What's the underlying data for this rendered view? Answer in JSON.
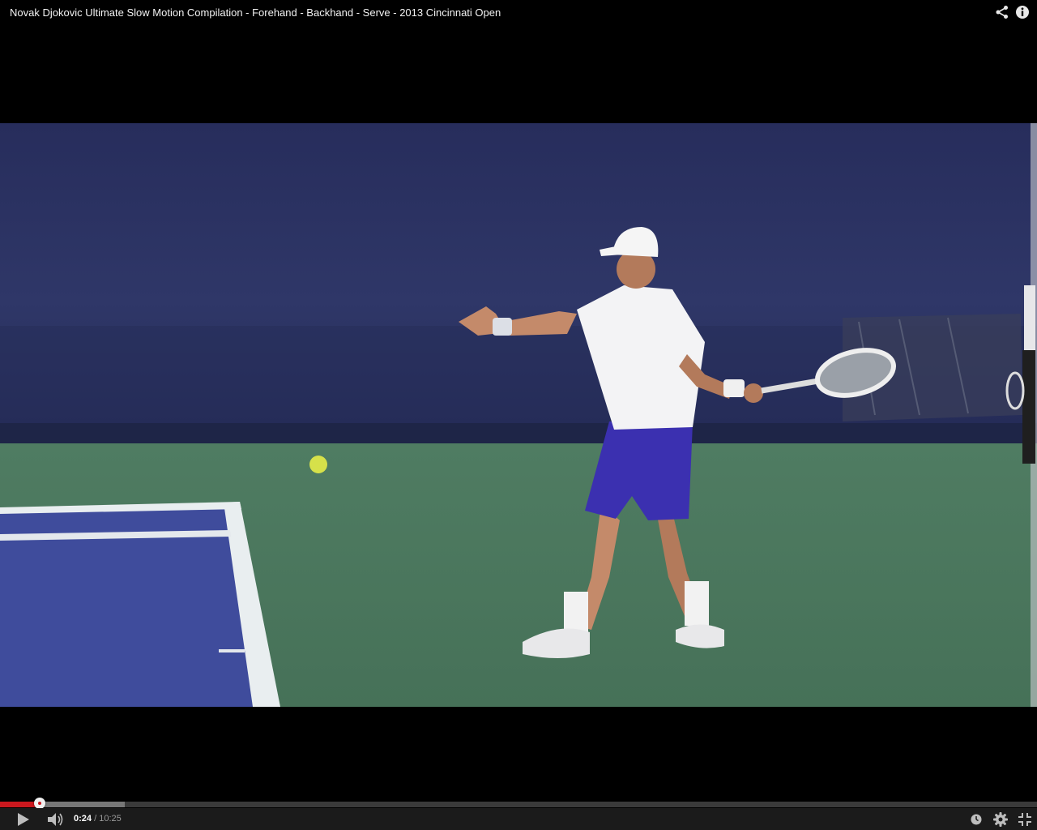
{
  "window": {
    "title": "Novak Djokovic Ultimate Slow Motion Compilation - Forehand - Backhand - Serve - 2013 Cincinnati Open"
  },
  "top_icons": {
    "share": "share-icon",
    "info": "info-icon"
  },
  "player": {
    "current_time": "0:24",
    "separator": " / ",
    "duration": "10:25",
    "played_fraction": 0.0384,
    "loaded_fraction": 0.12,
    "state": "paused"
  },
  "controls": {
    "play": "play-icon",
    "volume": "volume-icon",
    "watch_later": "clock-icon",
    "settings": "gear-icon",
    "fullscreen": "exit-fullscreen-icon"
  },
  "colors": {
    "progress_played": "#cc181e",
    "progress_loaded": "#777777",
    "progress_track": "#3a3a3a",
    "controls_bg": "#1b1b1b",
    "court_blue": "#3c4a9a",
    "court_green": "#4c7a5e",
    "wall_navy": "#2c3465"
  }
}
